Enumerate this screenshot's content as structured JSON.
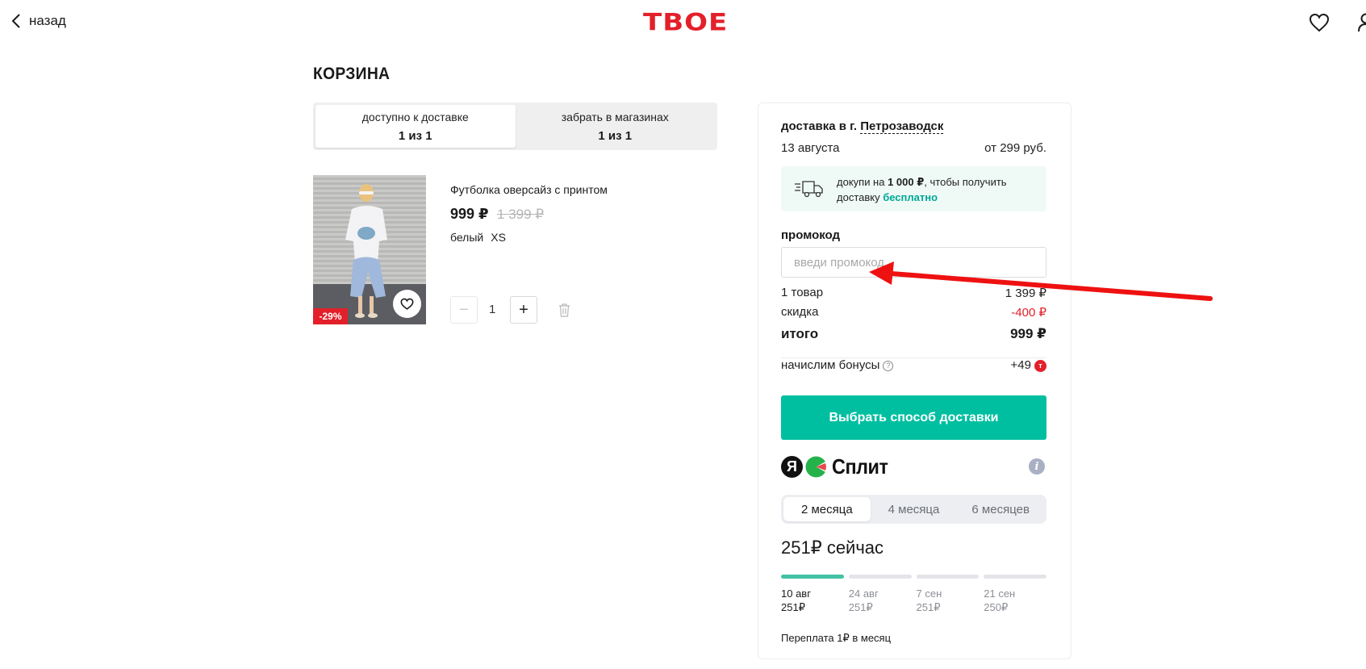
{
  "header": {
    "back_label": "назад",
    "logo_text": "ТВОЕ",
    "brand_color": "#e3202a",
    "icons": [
      "chevron-left-icon",
      "heart-icon",
      "user-icon"
    ]
  },
  "cart": {
    "title": "КОРЗИНА",
    "tabs": [
      {
        "label": "доступно к доставке",
        "count": "1 из 1",
        "active": true
      },
      {
        "label": "забрать в магазинах",
        "count": "1 из 1",
        "active": false
      }
    ],
    "item": {
      "name": "Футболка оверсайз с принтом",
      "price": "999 ₽",
      "old_price": "1 399 ₽",
      "color": "белый",
      "size": "XS",
      "discount_badge": "-29%",
      "quantity": "1",
      "minus": "−",
      "plus": "+"
    }
  },
  "summary": {
    "delivery_prefix": "доставка в г.",
    "city": "Петрозаводск",
    "date": "13 августа",
    "delivery_price": "от 299 руб.",
    "free_delivery_note": {
      "part1": "докупи на ",
      "amount": "1 000 ₽",
      "part2": ", чтобы получить",
      "part3": "доставку ",
      "free": "бесплатно"
    },
    "promo_label": "промокод",
    "promo_placeholder": "введи промокод",
    "items_label": "1 товар",
    "items_value": "1 399 ₽",
    "discount_label": "скидка",
    "discount_value": "-400 ₽",
    "total_label": "итого",
    "total_value": "999 ₽",
    "bonus_label": "начислим бонусы",
    "bonus_value": "+49",
    "bonus_icon_text": "т",
    "cta_label": "Выбрать способ доставки",
    "accent_color": "#00bfa1"
  },
  "split": {
    "logo_ya": "Я",
    "logo_word": "Сплит",
    "info_icon": "i",
    "months": [
      {
        "label": "2 месяца",
        "active": true
      },
      {
        "label": "4 месяца",
        "active": false
      },
      {
        "label": "6 месяцев",
        "active": false
      }
    ],
    "now_text": "251₽ сейчас",
    "schedule": [
      {
        "date": "10 авг",
        "amount": "251₽",
        "paid": true
      },
      {
        "date": "24 авг",
        "amount": "251₽",
        "paid": false
      },
      {
        "date": "7 сен",
        "amount": "251₽",
        "paid": false
      },
      {
        "date": "21 сен",
        "amount": "250₽",
        "paid": false
      }
    ],
    "overpay": "Переплата 1₽ в месяц"
  }
}
